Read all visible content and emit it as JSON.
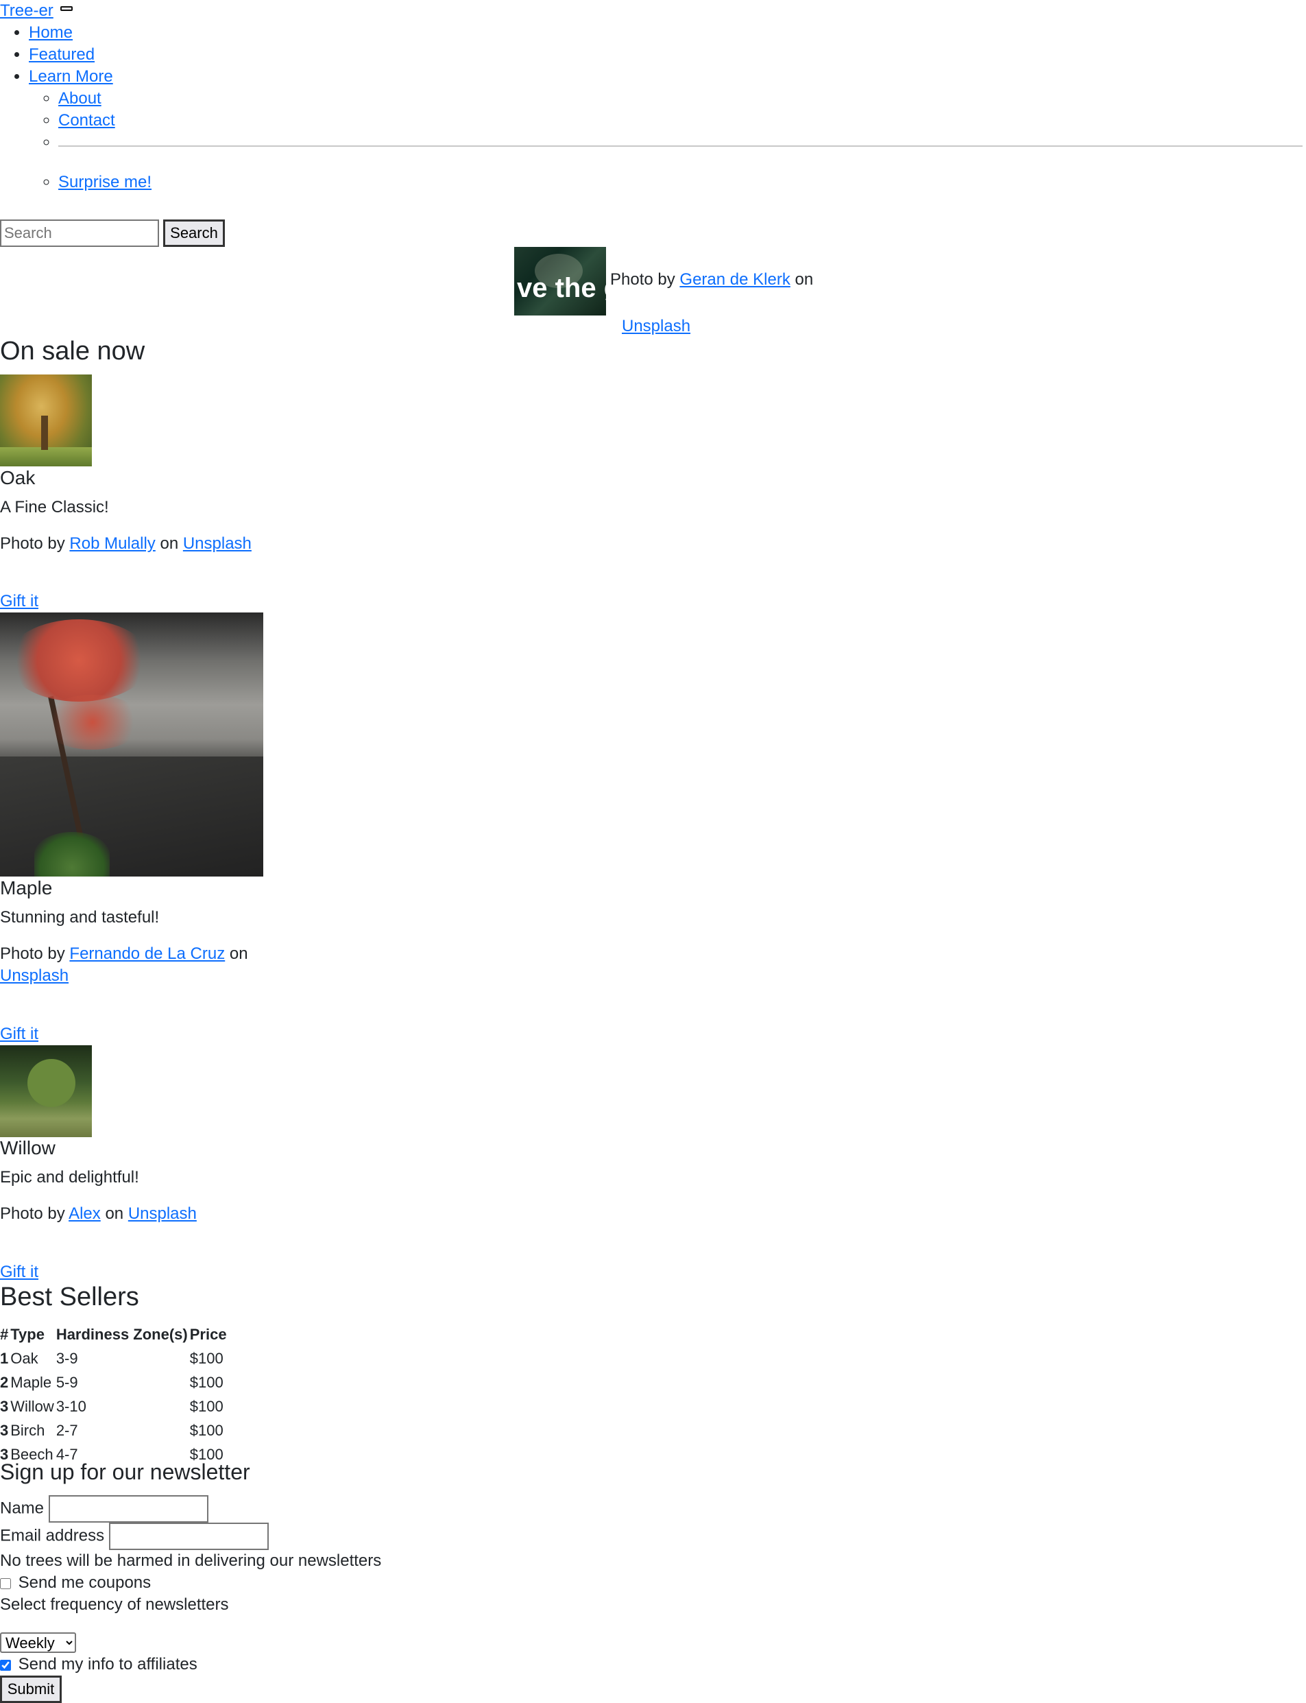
{
  "navbar": {
    "brand": "Tree-er",
    "items": [
      "Home",
      "Featured",
      "Learn More"
    ],
    "dropdown": [
      "About",
      "Contact",
      "Surprise me!"
    ]
  },
  "search": {
    "placeholder": "Search",
    "button": "Search"
  },
  "hero": {
    "image_text": "ve the g",
    "caption_prefix": "Photo by",
    "photographer": "Geran de Klerk",
    "caption_on": "on",
    "source": "Unsplash"
  },
  "on_sale": {
    "heading": "On sale now",
    "cards": [
      {
        "title": "Oak",
        "text": "A Fine Classic!",
        "photo_by": "Photo by",
        "photographer": "Rob Mulally",
        "on": "on",
        "source": "Unsplash",
        "cta": "Gift it"
      },
      {
        "title": "Maple",
        "text": "Stunning and tasteful!",
        "photo_by": "Photo by",
        "photographer": "Fernando de La Cruz",
        "on": "on",
        "source": "Unsplash",
        "cta": "Gift it"
      },
      {
        "title": "Willow",
        "text": "Epic and delightful!",
        "photo_by": "Photo by",
        "photographer": "Alex",
        "on": "on",
        "source": "Unsplash",
        "cta": "Gift it"
      }
    ]
  },
  "best_sellers": {
    "heading": "Best Sellers",
    "columns": [
      "#",
      "Type",
      "Hardiness Zone(s)",
      "Price"
    ],
    "rows": [
      [
        "1",
        "Oak",
        "3-9",
        "$100"
      ],
      [
        "2",
        "Maple",
        "5-9",
        "$100"
      ],
      [
        "3",
        "Willow",
        "3-10",
        "$100"
      ],
      [
        "3",
        "Birch",
        "2-7",
        "$100"
      ],
      [
        "3",
        "Beech",
        "4-7",
        "$100"
      ]
    ]
  },
  "newsletter": {
    "heading": "Sign up for our newsletter",
    "name_label": "Name",
    "name_value": "",
    "email_label": "Email address",
    "email_value": "",
    "help_text": "No trees will be harmed in delivering our newsletters",
    "coupons_label": "Send me coupons",
    "coupons_checked": false,
    "frequency_label": "Select frequency of newsletters",
    "frequency_selected": "Weekly",
    "affiliates_label": "Send my info to affiliates",
    "affiliates_checked": true,
    "submit": "Submit"
  },
  "colors": {
    "link": "#0d6efd",
    "text": "#212529"
  }
}
